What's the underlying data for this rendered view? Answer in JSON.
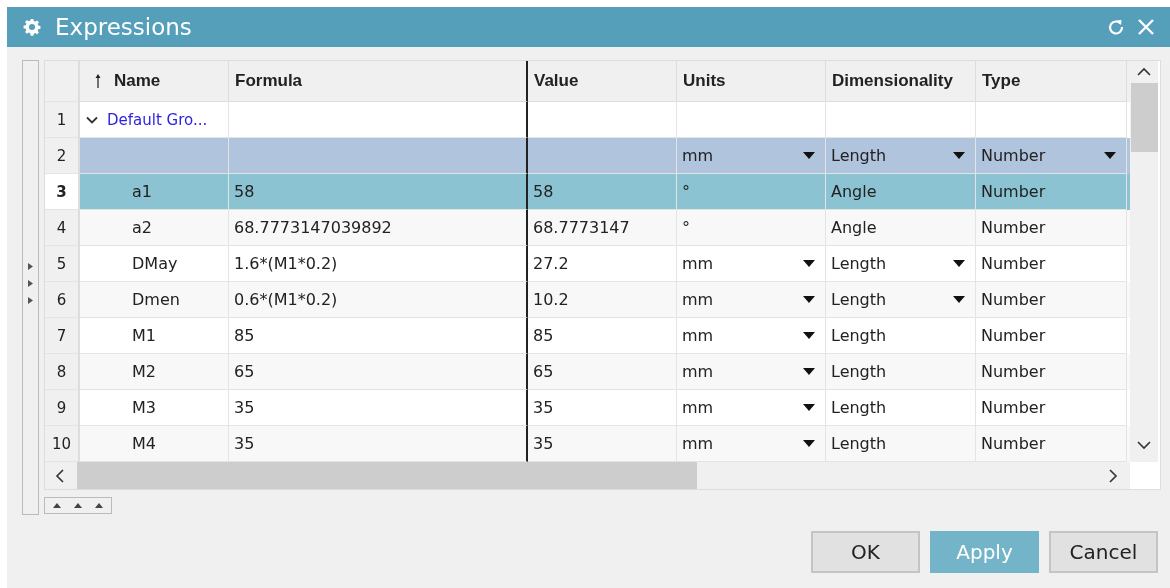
{
  "window": {
    "title": "Expressions"
  },
  "table": {
    "columns": [
      {
        "label": "Name",
        "sorted": true
      },
      {
        "label": "Formula",
        "sorted": false
      },
      {
        "label": "Value",
        "sorted": false
      },
      {
        "label": "Units",
        "sorted": false
      },
      {
        "label": "Dimensionality",
        "sorted": false
      },
      {
        "label": "Type",
        "sorted": false
      }
    ],
    "rows": [
      {
        "kind": "group",
        "number": "1",
        "name": "Default Gro...",
        "expanded": true,
        "selected": false
      },
      {
        "kind": "filter",
        "number": "2",
        "selected": false,
        "units": {
          "text": "mm",
          "dropdown": true
        },
        "dimensionality": {
          "text": "Length",
          "dropdown": true
        },
        "type": {
          "text": "Number",
          "dropdown": true
        }
      },
      {
        "kind": "item",
        "number": "3",
        "name": "a1",
        "formula": "58",
        "value": "58",
        "selected": true,
        "units": {
          "text": "°",
          "dropdown": false
        },
        "dimensionality": {
          "text": "Angle",
          "dropdown": false
        },
        "type": {
          "text": "Number",
          "dropdown": false
        }
      },
      {
        "kind": "item",
        "number": "4",
        "name": "a2",
        "formula": "68.7773147039892",
        "value": "68.7773147",
        "selected": false,
        "units": {
          "text": "°",
          "dropdown": false
        },
        "dimensionality": {
          "text": "Angle",
          "dropdown": false
        },
        "type": {
          "text": "Number",
          "dropdown": false
        }
      },
      {
        "kind": "item",
        "number": "5",
        "name": "DMay",
        "formula": "1.6*(M1*0.2)",
        "value": "27.2",
        "selected": false,
        "units": {
          "text": "mm",
          "dropdown": true
        },
        "dimensionality": {
          "text": "Length",
          "dropdown": true
        },
        "type": {
          "text": "Number",
          "dropdown": false
        }
      },
      {
        "kind": "item",
        "number": "6",
        "name": "Dmen",
        "formula": "0.6*(M1*0.2)",
        "value": "10.2",
        "selected": false,
        "units": {
          "text": "mm",
          "dropdown": true
        },
        "dimensionality": {
          "text": "Length",
          "dropdown": true
        },
        "type": {
          "text": "Number",
          "dropdown": false
        }
      },
      {
        "kind": "item",
        "number": "7",
        "name": "M1",
        "formula": "85",
        "value": "85",
        "selected": false,
        "units": {
          "text": "mm",
          "dropdown": true
        },
        "dimensionality": {
          "text": "Length",
          "dropdown": false
        },
        "type": {
          "text": "Number",
          "dropdown": false
        }
      },
      {
        "kind": "item",
        "number": "8",
        "name": "M2",
        "formula": "65",
        "value": "65",
        "selected": false,
        "units": {
          "text": "mm",
          "dropdown": true
        },
        "dimensionality": {
          "text": "Length",
          "dropdown": false
        },
        "type": {
          "text": "Number",
          "dropdown": false
        }
      },
      {
        "kind": "item",
        "number": "9",
        "name": "M3",
        "formula": "35",
        "value": "35",
        "selected": false,
        "units": {
          "text": "mm",
          "dropdown": true
        },
        "dimensionality": {
          "text": "Length",
          "dropdown": false
        },
        "type": {
          "text": "Number",
          "dropdown": false
        }
      },
      {
        "kind": "item",
        "number": "10",
        "name": "M4",
        "formula": "35",
        "value": "35",
        "selected": false,
        "units": {
          "text": "mm",
          "dropdown": true
        },
        "dimensionality": {
          "text": "Length",
          "dropdown": false
        },
        "type": {
          "text": "Number",
          "dropdown": false
        }
      }
    ]
  },
  "buttons": [
    {
      "label": "OK",
      "highlighted": false
    },
    {
      "label": "Apply",
      "highlighted": true
    },
    {
      "label": "Cancel",
      "highlighted": false
    }
  ]
}
